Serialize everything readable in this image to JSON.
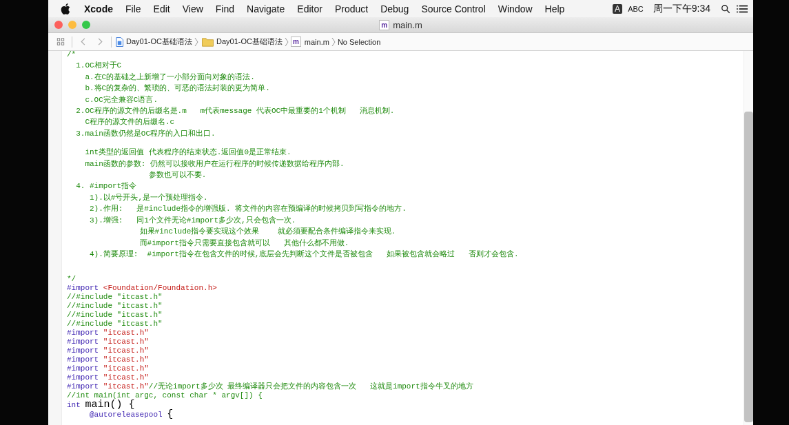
{
  "menu_bar": {
    "app": "Xcode",
    "items": [
      "File",
      "Edit",
      "View",
      "Find",
      "Navigate",
      "Editor",
      "Product",
      "Debug",
      "Source Control",
      "Window",
      "Help"
    ],
    "input_badge": "A",
    "input_source": "ABC",
    "clock": "周一下午9:34"
  },
  "window": {
    "title": "main.m",
    "title_icon_letter": "m"
  },
  "jump_bar": {
    "crumbs": [
      {
        "kind": "project",
        "label": "Day01-OC基础语法"
      },
      {
        "kind": "folder",
        "label": "Day01-OC基础语法"
      },
      {
        "kind": "file",
        "label": "main.m",
        "icon_letter": "m"
      },
      {
        "kind": "text",
        "label": "No Selection"
      }
    ]
  },
  "editor": {
    "lines": [
      {
        "kind": "code",
        "segments": [
          {
            "kind": "comment",
            "text": "/*"
          }
        ]
      },
      {
        "kind": "code",
        "segments": [
          {
            "kind": "comment",
            "text": "  1.OC相对于C"
          }
        ]
      },
      {
        "kind": "code",
        "segments": [
          {
            "kind": "comment",
            "text": "    a.在C的基础之上新增了一小部分面向对象的语法."
          }
        ]
      },
      {
        "kind": "code",
        "segments": [
          {
            "kind": "comment",
            "text": "    b.将C的复杂的、繁琐的、可恶的语法封装的更为简单."
          }
        ]
      },
      {
        "kind": "code",
        "segments": [
          {
            "kind": "comment",
            "text": "    c.OC完全兼容C语言."
          }
        ]
      },
      {
        "kind": "code",
        "segments": [
          {
            "kind": "comment",
            "text": "  2.OC程序的源文件的后缀名是.m   m代表message 代表OC中最重要的1个机制   消息机制."
          }
        ]
      },
      {
        "kind": "code",
        "segments": [
          {
            "kind": "comment",
            "text": "    C程序的源文件的后缀名.c"
          }
        ]
      },
      {
        "kind": "code",
        "segments": [
          {
            "kind": "comment",
            "text": "  3.main函数仍然是OC程序的入口和出口."
          }
        ]
      },
      {
        "kind": "blank"
      },
      {
        "kind": "code",
        "segments": [
          {
            "kind": "comment",
            "text": "    int类型的返回值 代表程序的结束状态.返回值0是正常结束."
          }
        ]
      },
      {
        "kind": "code",
        "segments": [
          {
            "kind": "comment",
            "text": "    main函数的参数: 仍然可以接收用户在运行程序的时候传递数据给程序内部."
          }
        ]
      },
      {
        "kind": "code",
        "segments": [
          {
            "kind": "comment",
            "text": "                  参数也可以不要."
          }
        ]
      },
      {
        "kind": "code",
        "segments": [
          {
            "kind": "comment",
            "text": "  4. #import指令"
          }
        ]
      },
      {
        "kind": "code",
        "segments": [
          {
            "kind": "comment",
            "text": "     1).以#号开头,是一个预处理指令."
          }
        ]
      },
      {
        "kind": "code",
        "segments": [
          {
            "kind": "comment",
            "text": "     2).作用:   是#include指令的增强版. 将文件的内容在预编译的时候拷贝到写指令的地方."
          }
        ]
      },
      {
        "kind": "code",
        "segments": [
          {
            "kind": "comment",
            "text": "     3).增强:   同1个文件无论#import多少次,只会包含一次."
          }
        ]
      },
      {
        "kind": "code",
        "segments": [
          {
            "kind": "comment",
            "text": "                如果#include指令要实现这个效果    就必须要配合条件编译指令来实现."
          }
        ]
      },
      {
        "kind": "code",
        "segments": [
          {
            "kind": "comment",
            "text": "                而#import指令只需要直接包含就可以   其他什么都不用做."
          }
        ]
      },
      {
        "kind": "code",
        "segments": [
          {
            "kind": "comment",
            "text": "     4).简要原理:  #import指令在包含文件的时候,底层会先判断这个文件是否被包含   如果被包含就会略过   否则才会包含."
          }
        ]
      },
      {
        "kind": "blank"
      },
      {
        "kind": "blank"
      },
      {
        "kind": "code",
        "segments": [
          {
            "kind": "comment",
            "text": "*/"
          }
        ]
      },
      {
        "kind": "code",
        "segments": [
          {
            "kind": "keyword",
            "text": "#import"
          },
          {
            "kind": "string",
            "text": " <Foundation/Foundation.h>"
          }
        ]
      },
      {
        "kind": "code",
        "segments": [
          {
            "kind": "comment",
            "text": "//#include \"itcast.h\""
          }
        ]
      },
      {
        "kind": "code",
        "segments": [
          {
            "kind": "comment",
            "text": "//#include \"itcast.h\""
          }
        ]
      },
      {
        "kind": "code",
        "segments": [
          {
            "kind": "comment",
            "text": "//#include \"itcast.h\""
          }
        ]
      },
      {
        "kind": "code",
        "segments": [
          {
            "kind": "comment",
            "text": "//#include \"itcast.h\""
          }
        ]
      },
      {
        "kind": "code",
        "segments": [
          {
            "kind": "keyword",
            "text": "#import"
          },
          {
            "kind": "string",
            "text": " \"itcast.h\""
          }
        ]
      },
      {
        "kind": "code",
        "segments": [
          {
            "kind": "keyword",
            "text": "#import"
          },
          {
            "kind": "string",
            "text": " \"itcast.h\""
          }
        ]
      },
      {
        "kind": "code",
        "segments": [
          {
            "kind": "keyword",
            "text": "#import"
          },
          {
            "kind": "string",
            "text": " \"itcast.h\""
          }
        ]
      },
      {
        "kind": "code",
        "segments": [
          {
            "kind": "keyword",
            "text": "#import"
          },
          {
            "kind": "string",
            "text": " \"itcast.h\""
          }
        ]
      },
      {
        "kind": "code",
        "segments": [
          {
            "kind": "keyword",
            "text": "#import"
          },
          {
            "kind": "string",
            "text": " \"itcast.h\""
          }
        ]
      },
      {
        "kind": "code",
        "segments": [
          {
            "kind": "keyword",
            "text": "#import"
          },
          {
            "kind": "string",
            "text": " \"itcast.h\""
          }
        ]
      },
      {
        "kind": "code",
        "segments": [
          {
            "kind": "keyword",
            "text": "#import"
          },
          {
            "kind": "string",
            "text": " \"itcast.h\""
          },
          {
            "kind": "comment",
            "text": "//无论import多少次 最终编译器只会把文件的内容包含一次   这就是import指令牛叉的地方"
          }
        ]
      },
      {
        "kind": "code",
        "segments": [
          {
            "kind": "comment",
            "text": "//int main(int argc, const char * argv[]) {"
          }
        ]
      },
      {
        "kind": "code",
        "segments": [
          {
            "kind": "keyword",
            "text": "int "
          },
          {
            "kind": "plain",
            "text": "main() {",
            "large": true
          }
        ]
      },
      {
        "kind": "code",
        "segments": [
          {
            "kind": "keyword",
            "text": "     @autoreleasepool "
          },
          {
            "kind": "plain",
            "text": "{",
            "large": true
          }
        ]
      }
    ]
  }
}
